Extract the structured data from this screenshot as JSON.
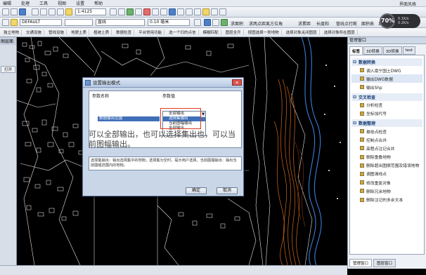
{
  "menu": {
    "items": [
      "编辑",
      "处理",
      "工具",
      "视图",
      "设置",
      "帮助"
    ],
    "window_title": "界面风格"
  },
  "toolbar": {
    "scale_value": "1:4125",
    "layer_value": "DEFAULT",
    "line_weight": "0.10 毫米",
    "line_type": "直线",
    "labels": [
      "求面积",
      "求两点距离方位角",
      "求累距",
      "长度和",
      "管线点打断",
      "面积表",
      "显示"
    ]
  },
  "toolbar3": {
    "items": [
      "独立地物",
      "交通设施",
      "管线设施",
      "地貌土质",
      "植被土质",
      "数据检查",
      "平台常用功能",
      "选一个扫的点信",
      "模糊匹配",
      "图层全开",
      "按图选择一类地物",
      "选择对象关闭图层",
      "选择对象所在图层"
    ]
  },
  "left_panel": {
    "title": "图层面",
    "item": "打开"
  },
  "right_panel": {
    "title": "管理窗口",
    "tabs": [
      "标签",
      "3D转换",
      "3D转换",
      "test"
    ],
    "sections": [
      {
        "title": "数据转换",
        "items": [
          "调入南宁国土DWG",
          "输出DWG数据",
          "输出Shp"
        ]
      },
      {
        "title": "交叉检查",
        "items": [
          "分析检查",
          "坐标加代号"
        ]
      },
      {
        "title": "数据整理",
        "items": [
          "悬挂点检查",
          "控制点合并",
          "高程点注记合并",
          "删除重叠地物",
          "删除超出图廓范围及错误地物",
          "调图清线点",
          "修改重复对象",
          "删除冗余地物",
          "删除注记的多余文本"
        ]
      }
    ],
    "selected_item": "输出DWG数据",
    "bottom_tabs": [
      "管理窗口",
      "图层窗口"
    ]
  },
  "dialog": {
    "title": "设置输出模式",
    "col_name_header": "参数名称",
    "col_value_header": "参数值",
    "row_name": "数据输出范围",
    "dropdown_items": [
      "全部输出",
      "选择集输出",
      "当前图幅输出",
      "全部输出"
    ],
    "highlight_index": 1,
    "annotation": "可以全部输出，也可以选择集出也，可以当前图幅输出。",
    "hint": "选择集输出：输出选择集中的地物；选择集为空时，提示用户选择。当前图幅输出：输出当前图幅范围内的地物。",
    "ok_label": "确定",
    "cancel_label": "取消",
    "close_label": "×"
  },
  "speed_widget": {
    "percent": "70%",
    "line1": "0.1K/s",
    "line2": "0.2K/s"
  },
  "colors": {
    "accent": "#3f6fb9",
    "annotation_arrow": "#e03a1e",
    "panel_bg": "#eef1f6"
  }
}
